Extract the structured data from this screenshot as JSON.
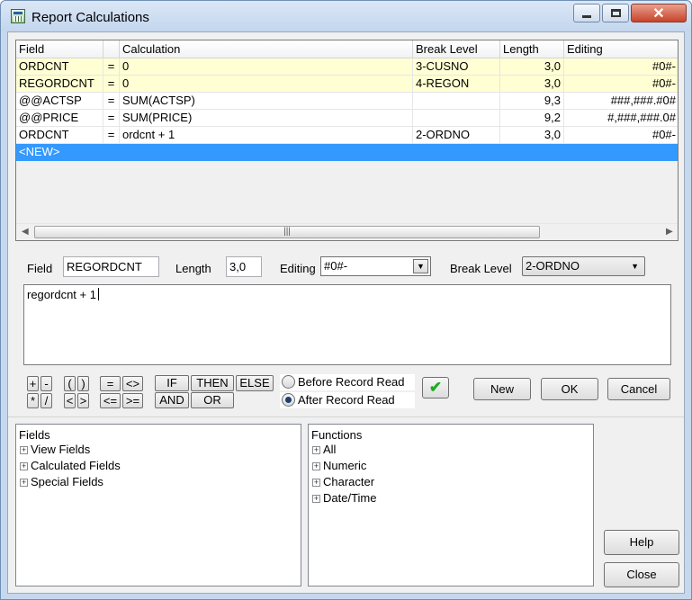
{
  "window": {
    "title": "Report Calculations"
  },
  "grid": {
    "columns": [
      "Field",
      "",
      "Calculation",
      "Break Level",
      "Length",
      "Editing"
    ],
    "rows": [
      {
        "field": "ORDCNT",
        "op": "=",
        "calc": "0",
        "break": "3-CUSNO",
        "length": "3,0",
        "editing": "#0#-"
      },
      {
        "field": "REGORDCNT",
        "op": "=",
        "calc": "0",
        "break": "4-REGON",
        "length": "3,0",
        "editing": "#0#-"
      },
      {
        "field": "@@ACTSP",
        "op": "=",
        "calc": "SUM(ACTSP)",
        "break": "",
        "length": "9,3",
        "editing": "###,###.#0#"
      },
      {
        "field": "@@PRICE",
        "op": "=",
        "calc": "SUM(PRICE)",
        "break": "",
        "length": "9,2",
        "editing": "#,###,###.0#"
      },
      {
        "field": "ORDCNT",
        "op": "=",
        "calc": "ordcnt + 1",
        "break": "2-ORDNO",
        "length": "3,0",
        "editing": "#0#-"
      }
    ],
    "new_row_label": "<NEW>"
  },
  "editor": {
    "field_label": "Field",
    "field_value": "REGORDCNT",
    "length_label": "Length",
    "length_value": "3,0",
    "editing_label": "Editing",
    "editing_value": "#0#-",
    "break_label": "Break Level",
    "break_value": "2-ORDNO",
    "expression": "regordcnt + 1"
  },
  "operators": {
    "plus": "+",
    "minus": "-",
    "times": "*",
    "divide": "/",
    "lparen": "(",
    "rparen": ")",
    "lt": "<",
    "gt": ">",
    "eq": "=",
    "ne": "<>",
    "le": "<=",
    "ge": ">=",
    "if": "IF",
    "then": "THEN",
    "else": "ELSE",
    "and": "AND",
    "or": "OR"
  },
  "timing": {
    "before": "Before Record Read",
    "after": "After Record Read",
    "selected": "after"
  },
  "buttons": {
    "new": "New",
    "ok": "OK",
    "cancel": "Cancel",
    "help": "Help",
    "close": "Close"
  },
  "fields_tree": {
    "title": "Fields",
    "items": [
      "View Fields",
      "Calculated Fields",
      "Special Fields"
    ]
  },
  "functions_tree": {
    "title": "Functions",
    "items": [
      "All",
      "Numeric",
      "Character",
      "Date/Time"
    ]
  },
  "colors": {
    "highlight_row": "#ffffd3",
    "selection": "#3399ff",
    "check": "#22aa22"
  }
}
